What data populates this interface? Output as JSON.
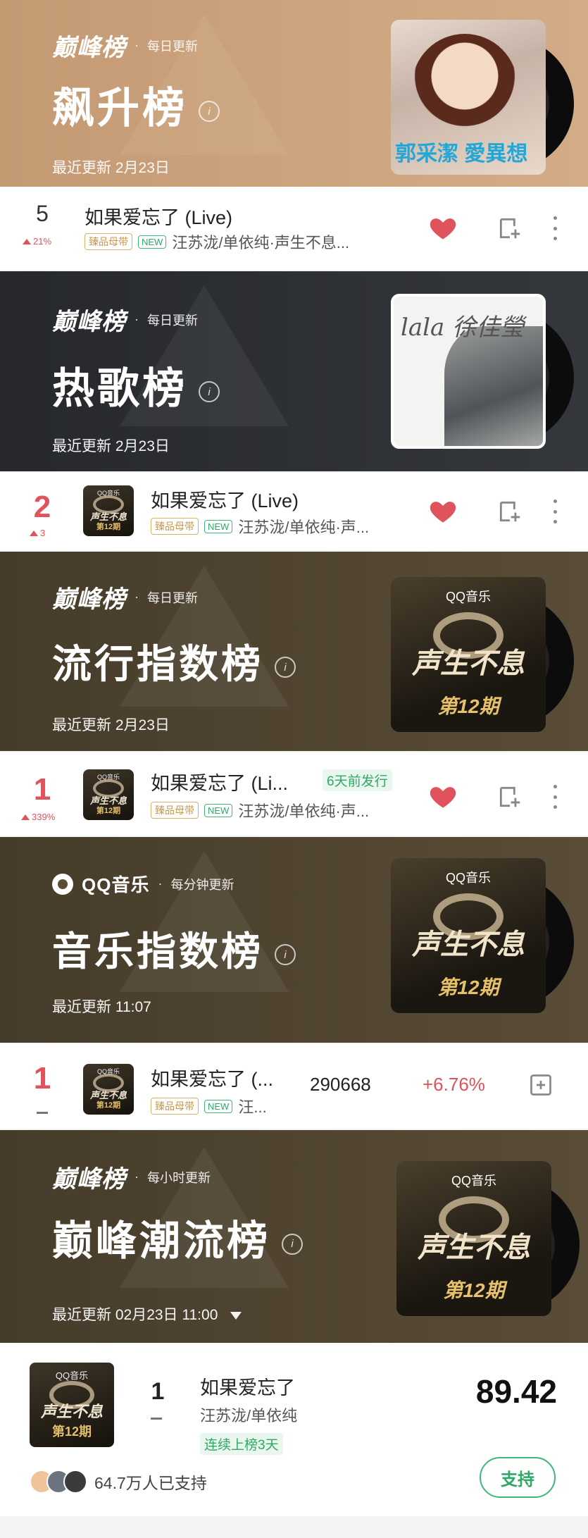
{
  "charts": {
    "soaring": {
      "brand": "巅峰榜",
      "frequency": "每日更新",
      "title": "飙升榜",
      "updated": "最近更新 2月23日",
      "cover_text": "郭采潔 愛異想",
      "song": {
        "rank": "5",
        "change": "21%",
        "title": "如果爱忘了 (Live)",
        "tag_gold": "臻品母带",
        "tag_new": "NEW",
        "artists": "汪苏泷/单依纯·声生不息..."
      }
    },
    "hot": {
      "brand": "巅峰榜",
      "frequency": "每日更新",
      "title": "热歌榜",
      "updated": "最近更新 2月23日",
      "cover_text": "lala 徐佳瑩",
      "song": {
        "rank": "2",
        "change": "3",
        "title": "如果爱忘了 (Live)",
        "tag_gold": "臻品母带",
        "tag_new": "NEW",
        "artists": "汪苏泷/单依纯·声..."
      }
    },
    "pop_index": {
      "brand": "巅峰榜",
      "frequency": "每日更新",
      "title": "流行指数榜",
      "updated": "最近更新 2月23日",
      "song": {
        "rank": "1",
        "change": "339%",
        "title": "如果爱忘了 (Li...",
        "release": "6天前发行",
        "tag_gold": "臻品母带",
        "tag_new": "NEW",
        "artists": "汪苏泷/单依纯·声..."
      }
    },
    "music_index": {
      "brand": "QQ音乐",
      "frequency": "每分钟更新",
      "title": "音乐指数榜",
      "updated": "最近更新 11:07",
      "song": {
        "rank": "1",
        "title": "如果爱忘了 (...",
        "tag_gold": "臻品母带",
        "tag_new": "NEW",
        "artists": "汪...",
        "index_value": "290668",
        "index_change": "+6.76%"
      }
    },
    "trend": {
      "brand": "巅峰榜",
      "frequency": "每小时更新",
      "title": "巅峰潮流榜",
      "updated": "最近更新 02月23日 11:00",
      "song": {
        "rank": "1",
        "title": "如果爱忘了",
        "artists": "汪苏泷/单依纯",
        "streak": "连续上榜3天",
        "score": "89.42",
        "supporters": "64.7万人已支持",
        "support_button": "支持"
      }
    }
  },
  "album_cover": {
    "logo": "QQ音乐",
    "title": "声生不息",
    "issue": "第12期"
  },
  "colors": {
    "soaring_bg": "#c9a07a",
    "hot_bg": "#2b2d31",
    "brown_bg": "#4a3f2d",
    "accent_red": "#e0525c",
    "accent_green": "#2fa865"
  }
}
